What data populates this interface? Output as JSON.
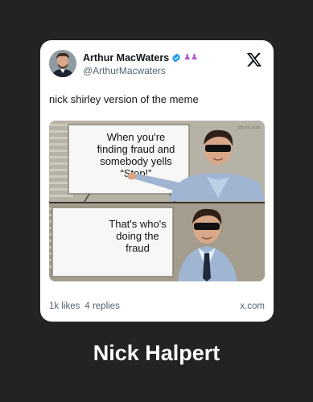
{
  "tweet": {
    "display_name": "Arthur MacWaters",
    "handle": "@ArthurMacwaters",
    "text": "nick shirley version of the meme",
    "likes": "1k likes",
    "replies": "4 replies",
    "source": "x.com"
  },
  "meme": {
    "board_top_lines": [
      "When you're",
      "finding fraud and",
      "somebody yells",
      "“Stop!”"
    ],
    "board_bottom_lines": [
      "That's who's",
      "doing the",
      "fraud"
    ],
    "watermark": "@cant_trust"
  },
  "caption": "Nick Halpert",
  "colors": {
    "background": "#232323",
    "card": "#ffffff",
    "verified": "#1d9bf0"
  },
  "icons": [
    "verified-badge-icon",
    "people-emoji-icon",
    "x-logo-icon"
  ]
}
